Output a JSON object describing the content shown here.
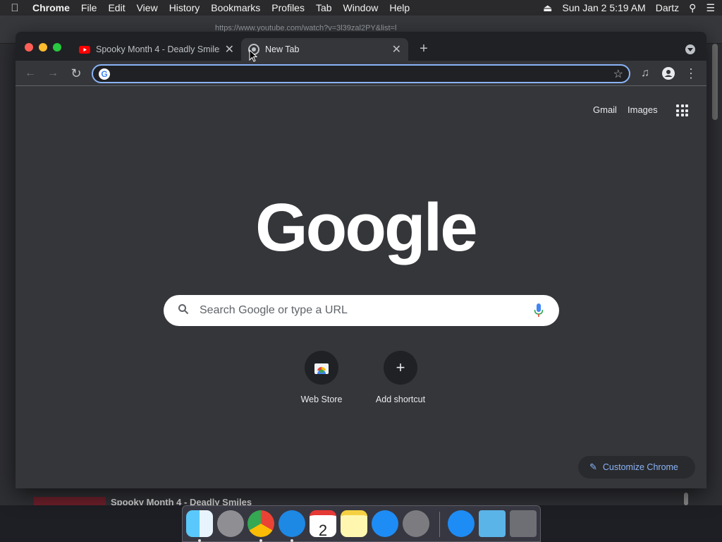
{
  "menubar": {
    "app": "Chrome",
    "items": [
      "File",
      "Edit",
      "View",
      "History",
      "Bookmarks",
      "Profiles",
      "Tab",
      "Window",
      "Help"
    ],
    "datetime": "Sun Jan 2  5:19 AM",
    "user": "Dartz"
  },
  "background_window": {
    "url": "https://www.youtube.com/watch?v=3l39zal2PY&list=l",
    "video_title": "Spooky Month 4 - Deadly Smiles"
  },
  "tabs": [
    {
      "title": "Spooky Month 4 - Deadly Smiles",
      "icon": "youtube-icon",
      "active": false
    },
    {
      "title": "New Tab",
      "icon": "chrome-icon",
      "active": true
    }
  ],
  "omnibox": {
    "value": "",
    "placeholder": ""
  },
  "ntp": {
    "gmail": "Gmail",
    "images": "Images",
    "logo": "Google",
    "search_placeholder": "Search Google or type a URL",
    "shortcuts": [
      {
        "label": "Web Store",
        "icon": "web-store-icon"
      },
      {
        "label": "Add shortcut",
        "icon": "plus-icon"
      }
    ],
    "customize": "Customize Chrome"
  },
  "colors": {
    "accent": "#8ab4f8",
    "background": "#35363a",
    "tabstrip": "#202124"
  },
  "dock": [
    "Finder",
    "Launchpad",
    "Google Chrome",
    "Safari",
    "Calendar",
    "Notes",
    "App Store",
    "System Preferences",
    "App Store",
    "Downloads",
    "Trash"
  ],
  "calendar_day": "2"
}
